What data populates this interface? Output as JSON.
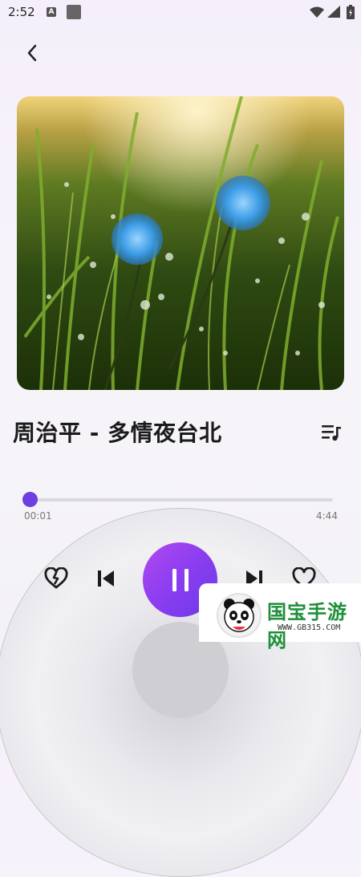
{
  "status_bar": {
    "time": "2:52",
    "a_icon": "A",
    "wifi_icon": "wifi-icon",
    "signal_icon": "signal-icon",
    "battery_icon": "battery-icon"
  },
  "header": {
    "back_icon": "back-arrow-icon"
  },
  "album": {
    "art_icon": "album-art-image"
  },
  "song": {
    "title": "周治平 - 多情夜台北"
  },
  "progress": {
    "current": "00:01",
    "total": "4:44",
    "fraction": 0.0035
  },
  "controls": {
    "dislike_icon": "broken-heart-icon",
    "prev_icon": "skip-previous-icon",
    "play_pause_icon": "pause-icon",
    "next_icon": "skip-next-icon",
    "like_icon": "heart-icon",
    "playlist_icon": "playlist-music-icon"
  },
  "watermark": {
    "brand": "国宝手游网",
    "url": "WWW.GB315.COM"
  },
  "colors": {
    "accent": "#6d3fe0",
    "play_gradient_start": "#b14af0",
    "play_gradient_end": "#6c3ae6",
    "watermark_green": "#1e8f3a"
  }
}
